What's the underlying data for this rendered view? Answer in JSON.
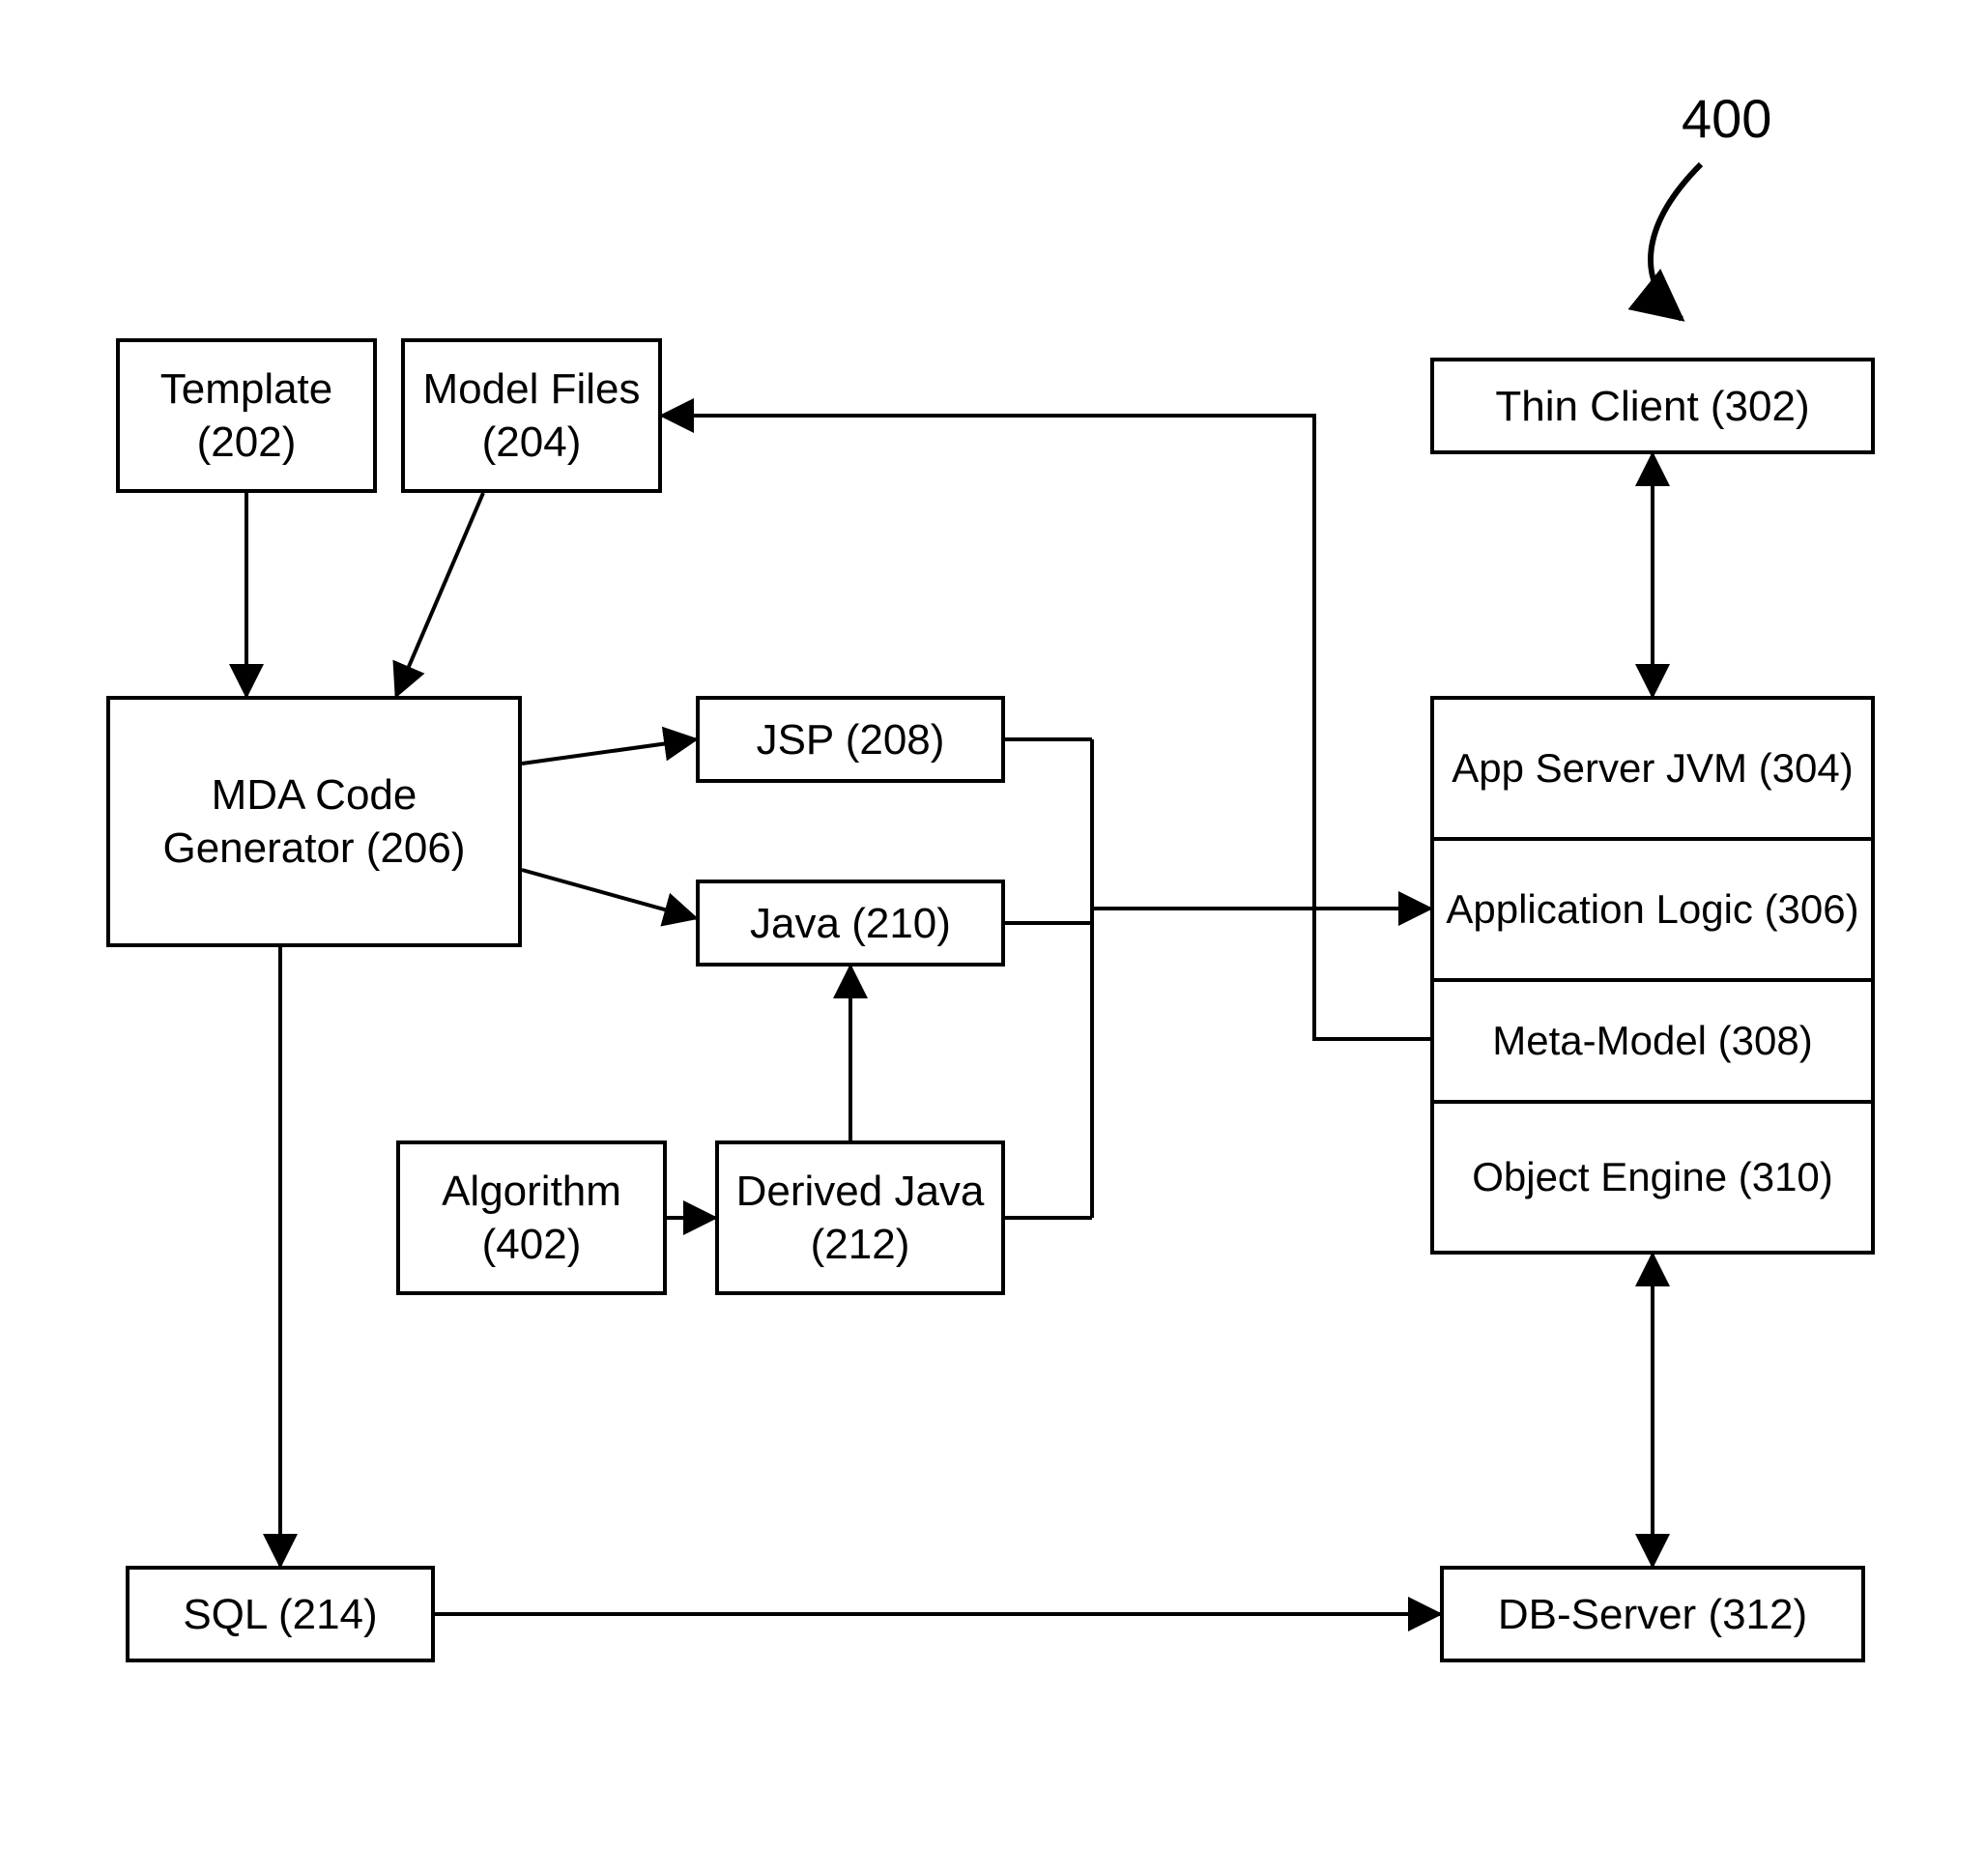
{
  "figure_label": "400",
  "boxes": {
    "template": "Template (202)",
    "model_files": "Model Files (204)",
    "mda": "MDA Code Generator (206)",
    "jsp": "JSP (208)",
    "java": "Java (210)",
    "algorithm": "Algorithm (402)",
    "derived_java": "Derived Java (212)",
    "sql": "SQL (214)",
    "thin_client": "Thin Client (302)",
    "app_server": "App Server JVM (304)",
    "app_logic": "Application Logic (306)",
    "meta_model": "Meta-Model (308)",
    "obj_engine": "Object Engine (310)",
    "db_server": "DB-Server (312)"
  }
}
